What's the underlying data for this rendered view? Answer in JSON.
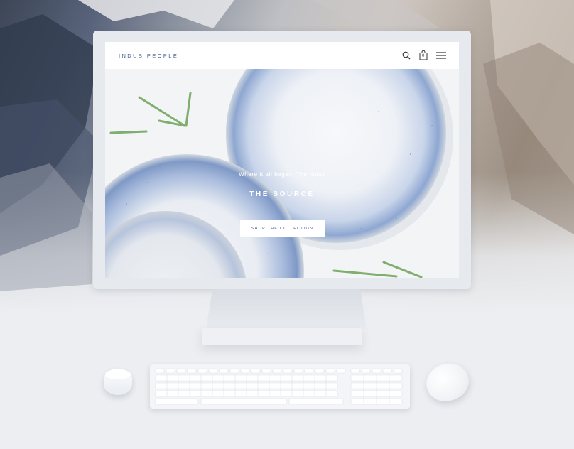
{
  "site": {
    "brand": "INDUS PEOPLE",
    "cart_count": "0",
    "tagline": "Where it all began: The Indus",
    "hero_title": "THE SOURCE",
    "cta_label": "SHOP THE COLLECTION"
  },
  "icons": {
    "search": "search-icon",
    "cart": "shopping-bag-icon",
    "menu": "hamburger-menu-icon"
  },
  "colors": {
    "brand": "#3f5a8c",
    "plate_blue": "#8ea7d1",
    "sprig_green": "#7fae6e",
    "device_white": "#e6e9ee"
  }
}
